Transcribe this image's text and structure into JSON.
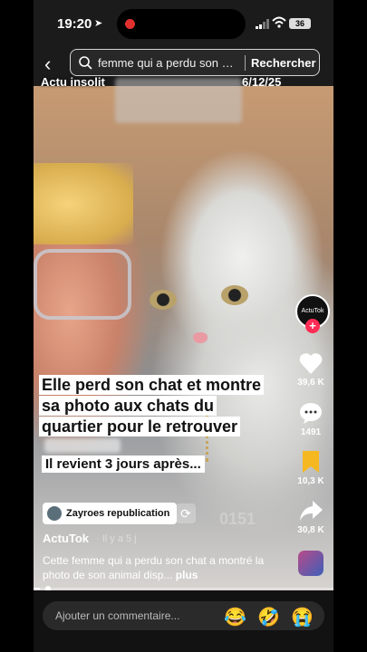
{
  "status": {
    "time": "19:20",
    "battery": "36"
  },
  "search": {
    "query": "femme qui a perdu son c...",
    "button": "Rechercher"
  },
  "video": {
    "overlay_account": "Actu insolit",
    "overlay_date": "6/12/25",
    "caption_lines": [
      "Elle perd son chat et montre",
      "sa photo aux chats du",
      "quartier pour le retrouver"
    ],
    "subcaption": "Il revient 3 jours après...",
    "watermark": "0151"
  },
  "rail": {
    "profile_label": "ActuTok",
    "likes": "39,6 K",
    "comments": "1491",
    "saves": "10,3 K",
    "shares": "30,8 K"
  },
  "post": {
    "repub_user": "Zayroes republication",
    "author": "ActuTok",
    "time": "· Il y a 5 j",
    "description": "Cette femme qui a perdu son chat a montré la photo de son animal disp...",
    "more": "plus",
    "progress": 0.02
  },
  "comment": {
    "placeholder": "Ajouter un commentaire...",
    "emojis": [
      "😂",
      "🤣",
      "😭"
    ]
  }
}
